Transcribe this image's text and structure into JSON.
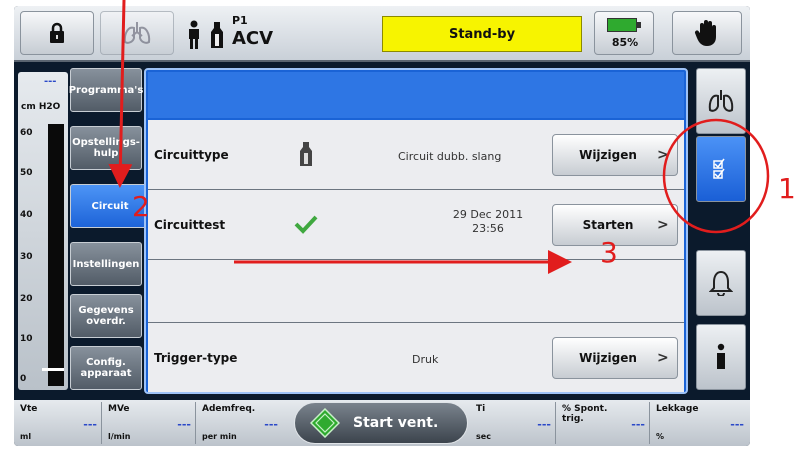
{
  "topbar": {
    "patient_id": "P1",
    "mode": "ACV",
    "status_text": "Stand-by",
    "battery_pct": "85%",
    "icons": [
      "lock-icon",
      "lungs-icon",
      "patient-icon",
      "circuit-icon",
      "battery-icon",
      "hand-icon"
    ]
  },
  "scale": {
    "dash": "---",
    "unit": "cm H2O",
    "ticks": [
      "60",
      "50",
      "40",
      "30",
      "20",
      "10",
      "0"
    ]
  },
  "nav": {
    "programs": "Programma's",
    "setup_help": "Opstellings-hulp",
    "circuit": "Circuit",
    "settings": "Instellingen",
    "data_transfer": "Gegevens overdr.",
    "config": "Config. apparaat"
  },
  "rows": {
    "circuit_type": {
      "label": "Circuittype",
      "value": "Circuit dubb. slang",
      "button": "Wijzigen"
    },
    "circuit_test": {
      "label": "Circuittest",
      "date": "29 Dec 2011",
      "time": "23:56",
      "button": "Starten"
    },
    "trigger_type": {
      "label": "Trigger-type",
      "value": "Druk",
      "button": "Wijzigen"
    }
  },
  "bottom": {
    "vte": {
      "name": "Vte",
      "unit": "ml",
      "value": "---"
    },
    "mve": {
      "name": "MVe",
      "unit": "l/min",
      "value": "---"
    },
    "rate": {
      "name": "Ademfreq.",
      "unit": "per min",
      "value": "---"
    },
    "start_label": "Start vent.",
    "ti": {
      "name": "Ti",
      "unit": "sec",
      "value": "---"
    },
    "spont": {
      "name": "% Spont. trig.",
      "unit": "",
      "value": "---"
    },
    "leak": {
      "name": "Lekkage",
      "unit": "%",
      "value": "---"
    }
  },
  "annotations": {
    "one": "1",
    "two": "2",
    "three": "3"
  },
  "colors": {
    "accent_blue": "#1d63d8",
    "status_yellow": "#f7f400",
    "annotation_red": "#e11d1d"
  }
}
